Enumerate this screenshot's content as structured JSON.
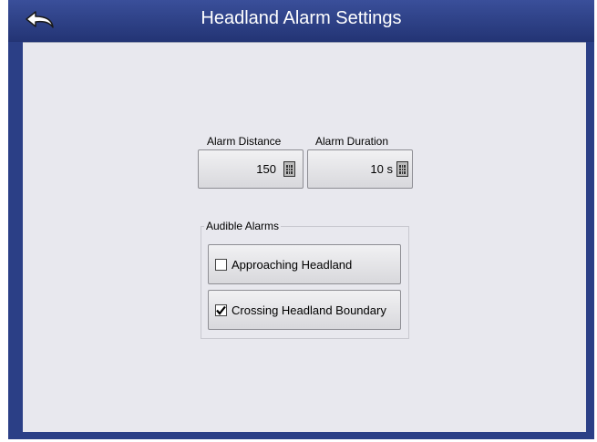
{
  "header": {
    "title": "Headland Alarm Settings",
    "back_icon": "undo-arrow-icon"
  },
  "alarm_distance": {
    "label": "Alarm Distance",
    "value": "150",
    "icon": "calculator-icon"
  },
  "alarm_duration": {
    "label": "Alarm Duration",
    "value": "10 s",
    "icon": "calculator-icon"
  },
  "audible_alarms": {
    "legend": "Audible Alarms",
    "items": [
      {
        "label": "Approaching Headland",
        "checked": false
      },
      {
        "label": "Crossing Headland Boundary",
        "checked": true
      }
    ]
  },
  "colors": {
    "titlebar": "#2b3f86",
    "background": "#e8e8ee"
  }
}
